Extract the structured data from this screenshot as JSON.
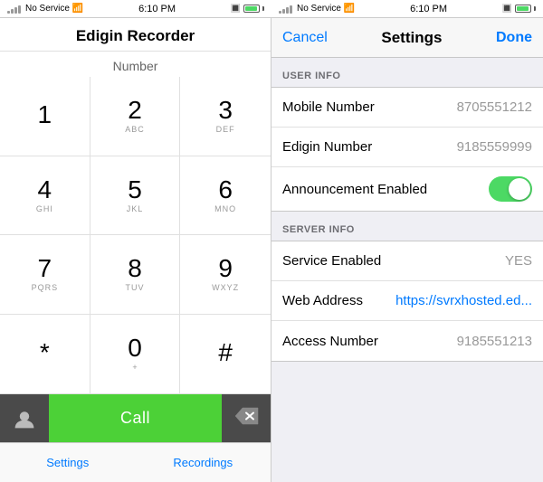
{
  "left_status": {
    "carrier": "No Service",
    "time": "6:10 PM",
    "bluetooth": "BT"
  },
  "right_status": {
    "carrier": "No Service",
    "time": "6:10 PM",
    "bluetooth": "BT"
  },
  "dialer": {
    "title": "Edigin Recorder",
    "number_label": "Number",
    "call_label": "Call",
    "keys": [
      {
        "num": "1",
        "sub": ""
      },
      {
        "num": "2",
        "sub": "ABC"
      },
      {
        "num": "3",
        "sub": "DEF"
      },
      {
        "num": "4",
        "sub": "GHI"
      },
      {
        "num": "5",
        "sub": "JKL"
      },
      {
        "num": "6",
        "sub": "MNO"
      },
      {
        "num": "7",
        "sub": "PQRS"
      },
      {
        "num": "8",
        "sub": "TUV"
      },
      {
        "num": "9",
        "sub": "WXYZ"
      },
      {
        "num": "*",
        "sub": ""
      },
      {
        "num": "0",
        "sub": "+"
      },
      {
        "num": "#",
        "sub": ""
      }
    ],
    "tabs": [
      {
        "label": "Settings",
        "id": "settings-tab"
      },
      {
        "label": "Recordings",
        "id": "recordings-tab"
      }
    ]
  },
  "settings": {
    "cancel_label": "Cancel",
    "title": "Settings",
    "done_label": "Done",
    "sections": [
      {
        "id": "user-info",
        "header": "USER INFO",
        "rows": [
          {
            "label": "Mobile Number",
            "value": "8705551212",
            "type": "text"
          },
          {
            "label": "Edigin Number",
            "value": "9185559999",
            "type": "text"
          },
          {
            "label": "Announcement Enabled",
            "value": "",
            "type": "toggle",
            "on": true
          }
        ]
      },
      {
        "id": "server-info",
        "header": "SERVER INFO",
        "rows": [
          {
            "label": "Service Enabled",
            "value": "YES",
            "type": "text"
          },
          {
            "label": "Web Address",
            "value": "https://svrxhosted.ed...",
            "type": "link"
          },
          {
            "label": "Access Number",
            "value": "9185551213",
            "type": "text"
          }
        ]
      }
    ]
  }
}
